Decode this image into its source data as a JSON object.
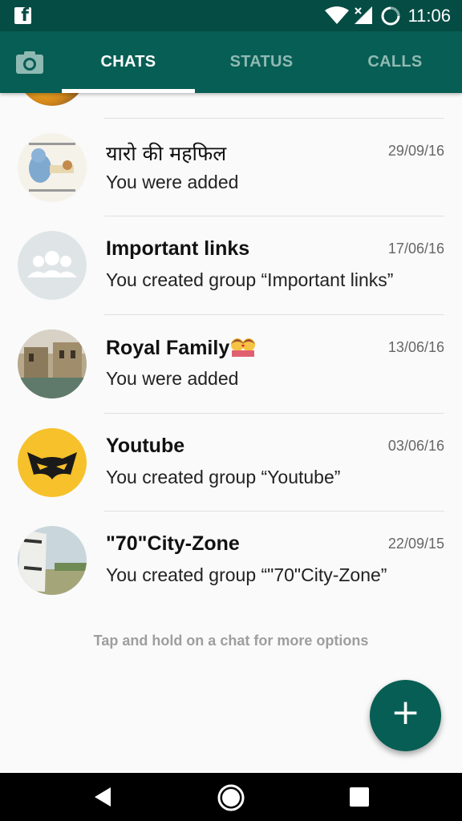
{
  "status_bar": {
    "time": "11:06",
    "app_icon": "facebook-icon",
    "icons": [
      "wifi-icon",
      "signal-icon",
      "battery-icon"
    ]
  },
  "tabs": [
    {
      "label": "CHATS",
      "active": true
    },
    {
      "label": "STATUS",
      "active": false
    },
    {
      "label": "CALLS",
      "active": false
    }
  ],
  "chats": [
    {
      "name": "यारो की महफिल",
      "date": "29/09/16",
      "message": "You were added"
    },
    {
      "name": "Important links",
      "date": "17/06/16",
      "message": "You created group “Important links”"
    },
    {
      "name": "Royal Family👩‍❤️‍👩",
      "name_text": "Royal Family",
      "date": "13/06/16",
      "message": "You were added"
    },
    {
      "name": "Youtube",
      "date": "03/06/16",
      "message": "You created group “Youtube”"
    },
    {
      "name": "\"70\"City-Zone",
      "date": "22/09/15",
      "message": "You created group “\"70\"City-Zone”"
    }
  ],
  "hint": "Tap and hold on a chat for more options",
  "colors": {
    "header": "#075e54",
    "status_bar": "#054c44",
    "fab": "#075e54"
  }
}
